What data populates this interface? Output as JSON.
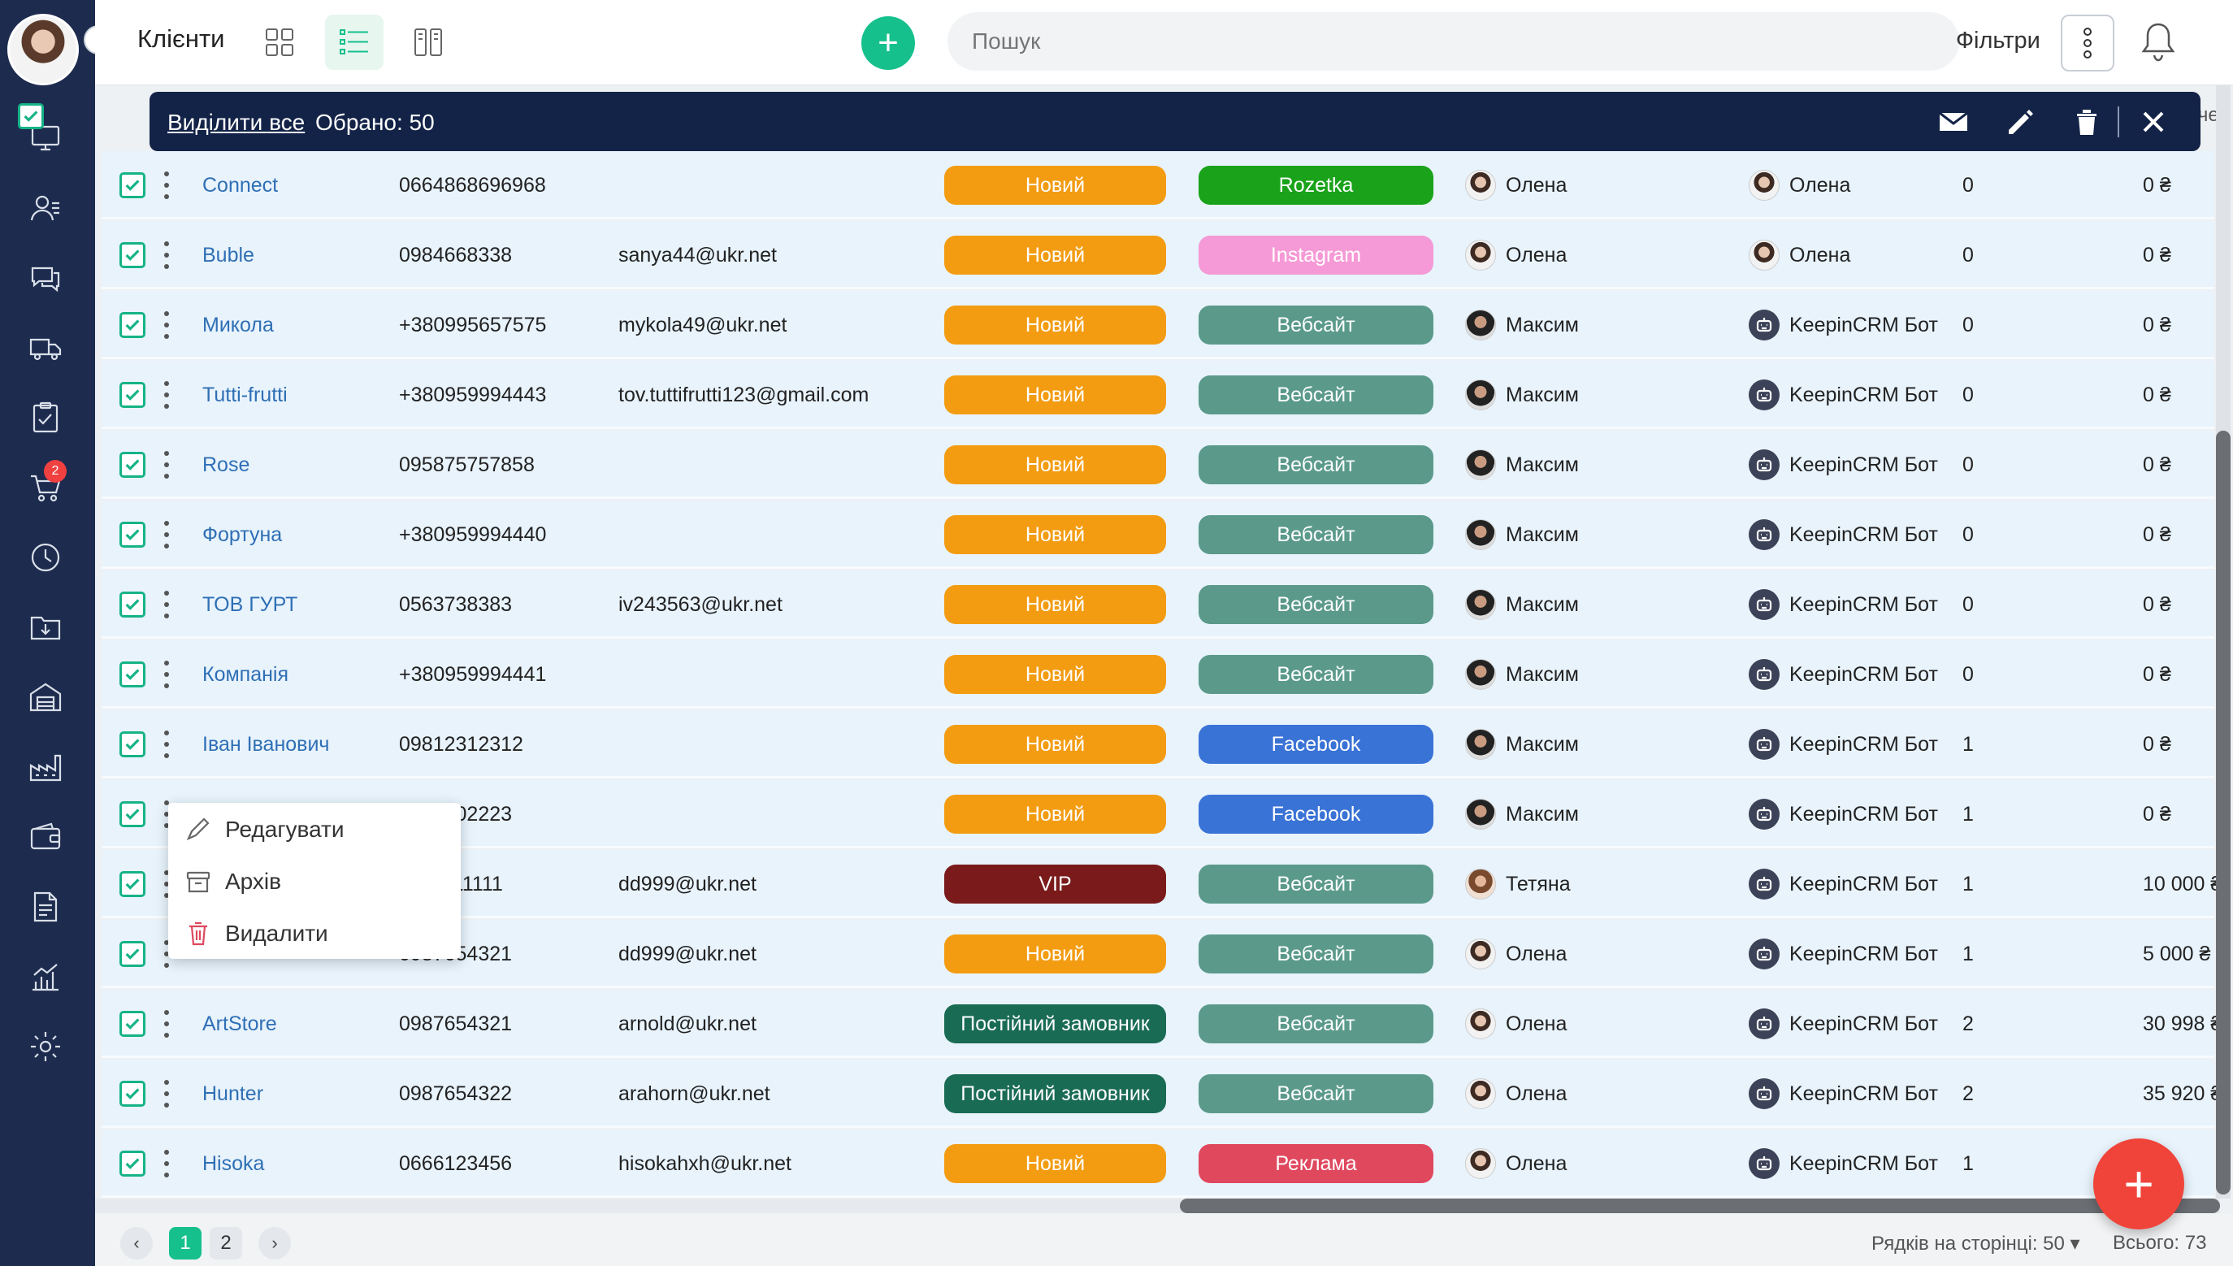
{
  "header": {
    "title": "Клієнти",
    "search_placeholder": "Пошук",
    "filters_label": "Фільтри"
  },
  "selection": {
    "select_all": "Виділити все",
    "selected": "Обрано: 50",
    "cut_header": "ачен"
  },
  "sidebar": {
    "items": [
      "desktop-icon",
      "contacts-icon",
      "chat-icon",
      "delivery-truck-icon",
      "clipboard-icon",
      "cart-icon",
      "clock-icon",
      "download-folder-icon",
      "warehouse-icon",
      "factory-icon",
      "wallet-icon",
      "document-icon",
      "analytics-icon",
      "settings-icon"
    ],
    "cart_badge": "2"
  },
  "colors": {
    "status_new": "#f39c12",
    "status_vip": "#7a1a1a",
    "status_regular": "#1a6b54",
    "source_rozetka": "#1aa31a",
    "source_instagram": "#f59ad6",
    "source_website": "#5b9a8b",
    "source_facebook": "#3a73d6",
    "source_ads": "#e0485e",
    "accent": "#16c08c"
  },
  "rows": [
    {
      "name": "Connect",
      "phone": "0664868696968",
      "email": "",
      "status": "Новий",
      "source": "Rozetka",
      "manager": "Олена",
      "mav": "o",
      "owner": "Олена",
      "owner_bot": false,
      "count": "0",
      "sum": "0 ₴"
    },
    {
      "name": "Buble",
      "phone": "0984668338",
      "email": "sanya44@ukr.net",
      "status": "Новий",
      "source": "Instagram",
      "manager": "Олена",
      "mav": "o",
      "owner": "Олена",
      "owner_bot": false,
      "count": "0",
      "sum": "0 ₴"
    },
    {
      "name": "Микола",
      "phone": "+380995657575",
      "email": "mykola49@ukr.net",
      "status": "Новий",
      "source": "Вебсайт",
      "manager": "Максим",
      "mav": "m",
      "owner": "KeepinCRM Бот",
      "owner_bot": true,
      "count": "0",
      "sum": "0 ₴"
    },
    {
      "name": "Tutti-frutti",
      "phone": "+380959994443",
      "email": "tov.tuttifrutti123@gmail.com",
      "status": "Новий",
      "source": "Вебсайт",
      "manager": "Максим",
      "mav": "m",
      "owner": "KeepinCRM Бот",
      "owner_bot": true,
      "count": "0",
      "sum": "0 ₴"
    },
    {
      "name": "Rose",
      "phone": "095875757858",
      "email": "",
      "status": "Новий",
      "source": "Вебсайт",
      "manager": "Максим",
      "mav": "m",
      "owner": "KeepinCRM Бот",
      "owner_bot": true,
      "count": "0",
      "sum": "0 ₴"
    },
    {
      "name": "Фортуна",
      "phone": "+380959994440",
      "email": "",
      "status": "Новий",
      "source": "Вебсайт",
      "manager": "Максим",
      "mav": "m",
      "owner": "KeepinCRM Бот",
      "owner_bot": true,
      "count": "0",
      "sum": "0 ₴"
    },
    {
      "name": "ТОВ ГУРТ",
      "phone": "0563738383",
      "email": "iv243563@ukr.net",
      "status": "Новий",
      "source": "Вебсайт",
      "manager": "Максим",
      "mav": "m",
      "owner": "KeepinCRM Бот",
      "owner_bot": true,
      "count": "0",
      "sum": "0 ₴"
    },
    {
      "name": "Компанія",
      "phone": "+380959994441",
      "email": "",
      "status": "Новий",
      "source": "Вебсайт",
      "manager": "Максим",
      "mav": "m",
      "owner": "KeepinCRM Бот",
      "owner_bot": true,
      "count": "0",
      "sum": "0 ₴"
    },
    {
      "name": "Іван Іванович",
      "phone": "09812312312",
      "email": "",
      "status": "Новий",
      "source": "Facebook",
      "manager": "Максим",
      "mav": "m",
      "owner": "KeepinCRM Бот",
      "owner_bot": true,
      "count": "1",
      "sum": "0 ₴"
    },
    {
      "name": "",
      "phone": "0950002223",
      "email": "",
      "status": "Новий",
      "source": "Facebook",
      "manager": "Максим",
      "mav": "m",
      "owner": "KeepinCRM Бот",
      "owner_bot": true,
      "count": "1",
      "sum": "0 ₴"
    },
    {
      "name": "",
      "phone": "0991111111",
      "email": "dd999@ukr.net",
      "status": "VIP",
      "source": "Вебсайт",
      "manager": "Тетяна",
      "mav": "t",
      "owner": "KeepinCRM Бот",
      "owner_bot": true,
      "count": "1",
      "sum": "10 000 ₴"
    },
    {
      "name": "",
      "phone": "0987654321",
      "email": "dd999@ukr.net",
      "status": "Новий",
      "source": "Вебсайт",
      "manager": "Олена",
      "mav": "o",
      "owner": "KeepinCRM Бот",
      "owner_bot": true,
      "count": "1",
      "sum": "5 000 ₴"
    },
    {
      "name": "ArtStore",
      "phone": "0987654321",
      "email": "arnold@ukr.net",
      "status": "Постійний замовник",
      "source": "Вебсайт",
      "manager": "Олена",
      "mav": "o",
      "owner": "KeepinCRM Бот",
      "owner_bot": true,
      "count": "2",
      "sum": "30 998 ₴"
    },
    {
      "name": "Hunter",
      "phone": "0987654322",
      "email": "arahorn@ukr.net",
      "status": "Постійний замовник",
      "source": "Вебсайт",
      "manager": "Олена",
      "mav": "o",
      "owner": "KeepinCRM Бот",
      "owner_bot": true,
      "count": "2",
      "sum": "35 920 ₴"
    },
    {
      "name": "Hisoka",
      "phone": "0666123456",
      "email": "hisokahxh@ukr.net",
      "status": "Новий",
      "source": "Реклама",
      "manager": "Олена",
      "mav": "o",
      "owner": "KeepinCRM Бот",
      "owner_bot": true,
      "count": "1",
      "sum": ""
    }
  ],
  "context_menu": {
    "edit": "Редагувати",
    "archive": "Архів",
    "delete": "Видалити"
  },
  "pagination": {
    "pages": [
      "1",
      "2"
    ],
    "current": "1",
    "rows_per_page": "Рядків на сторінці: 50",
    "total": "Всього: 73"
  }
}
